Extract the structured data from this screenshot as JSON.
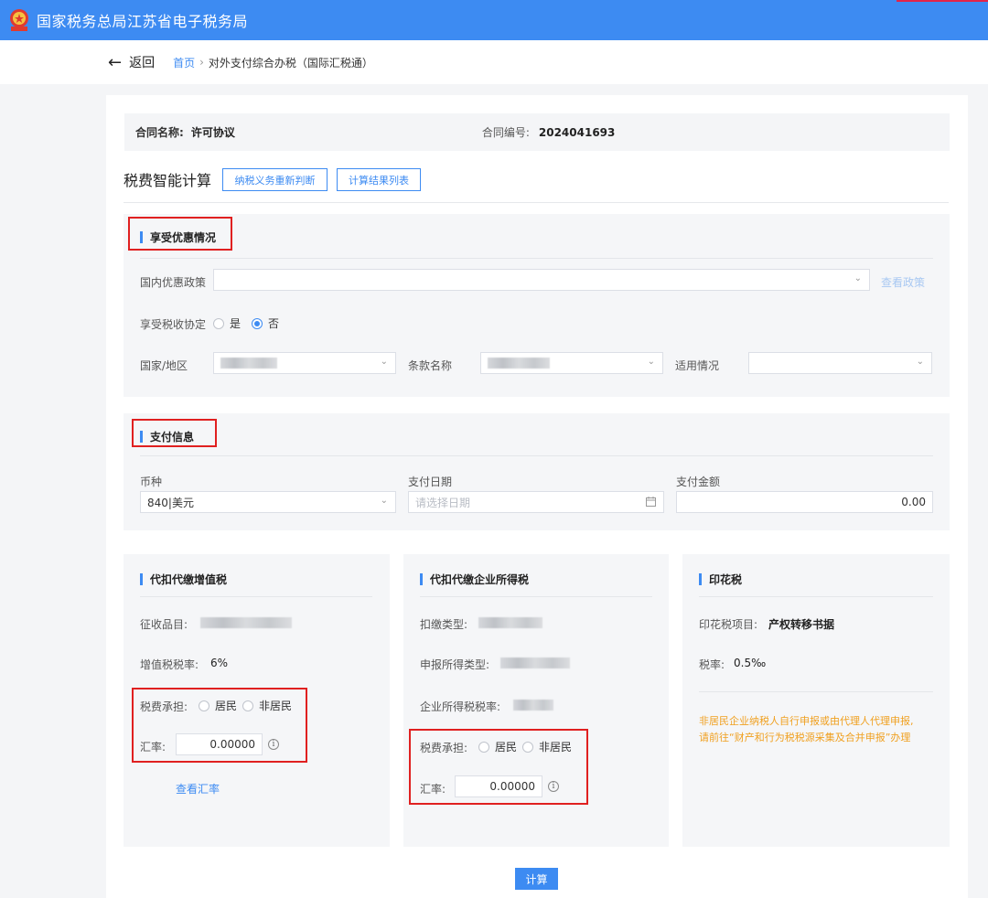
{
  "header": {
    "title": "国家税务总局江苏省电子税务局"
  },
  "nav": {
    "back_label": "返回",
    "crumb_home": "首页",
    "crumb_sep": "›",
    "crumb_current": "对外支付综合办税（国际汇税通）"
  },
  "contract": {
    "name_label": "合同名称:",
    "name_value": "许可协议",
    "no_label": "合同编号:",
    "no_value": "2024041693"
  },
  "calc": {
    "title": "税费智能计算",
    "btn_rejudge": "纳税义务重新判断",
    "btn_results": "计算结果列表"
  },
  "preference": {
    "title": "享受优惠情况",
    "domestic_label": "国内优惠政策",
    "domestic_value": "",
    "view_policy": "查看政策",
    "treaty_label": "享受税收协定",
    "treaty_yes": "是",
    "treaty_no": "否",
    "treaty_selected": "否",
    "country_label": "国家/地区",
    "clause_label": "条款名称",
    "situation_label": "适用情况"
  },
  "payment": {
    "title": "支付信息",
    "currency_label": "币种",
    "currency_value": "840|美元",
    "date_label": "支付日期",
    "date_placeholder": "请选择日期",
    "amount_label": "支付金额",
    "amount_value": "0.00"
  },
  "vat": {
    "title": "代扣代缴增值税",
    "item_label": "征收品目:",
    "rate_label": "增值税税率:",
    "rate_value": "6%",
    "burden_label": "税费承担:",
    "opt_resident": "居民",
    "opt_nonresident": "非居民",
    "fx_label": "汇率:",
    "fx_value": "0.00000",
    "view_fx": "查看汇率"
  },
  "cit": {
    "title": "代扣代缴企业所得税",
    "type_label": "扣缴类型:",
    "income_label": "申报所得类型:",
    "rate_label": "企业所得税税率:",
    "burden_label": "税费承担:",
    "opt_resident": "居民",
    "opt_nonresident": "非居民",
    "fx_label": "汇率:",
    "fx_value": "0.00000"
  },
  "stamp": {
    "title": "印花税",
    "item_label": "印花税项目:",
    "item_value": "产权转移书据",
    "rate_label": "税率:",
    "rate_value": "0.5‰",
    "notice_line1": "非居民企业纳税人自行申报或由代理人代理申报,",
    "notice_line2": "请前往“财产和行为税税源采集及合并申报”办理"
  },
  "calc_button": "计算",
  "colors": {
    "brand": "#3d8bf2",
    "highlight": "#e02020",
    "notice": "#f0a020"
  }
}
